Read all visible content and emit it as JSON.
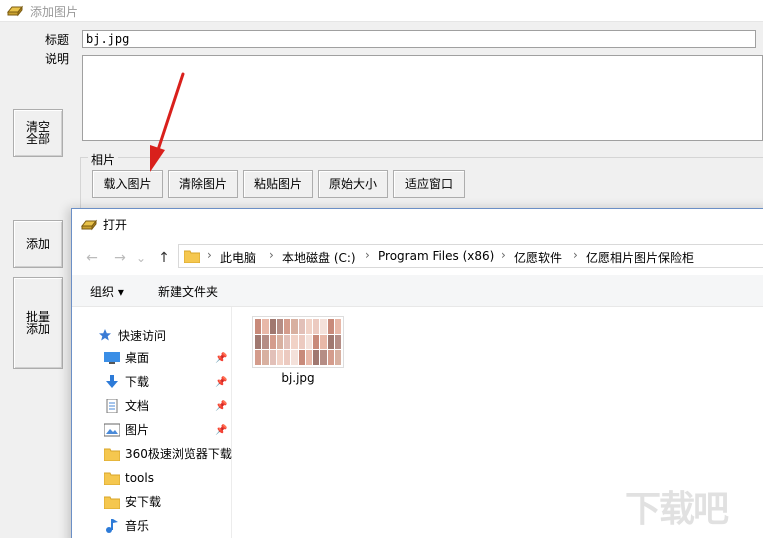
{
  "window": {
    "title": "添加图片"
  },
  "form": {
    "title_label": "标题",
    "title_value": "bj.jpg",
    "desc_label": "说明"
  },
  "side_buttons": {
    "clear_all": "清空全部",
    "add": "添加",
    "batch_add": "批量添加"
  },
  "photo_group": {
    "label": "相片",
    "buttons": [
      "载入图片",
      "清除图片",
      "粘贴图片",
      "原始大小",
      "适应窗口"
    ]
  },
  "dialog": {
    "title": "打开",
    "nav": {
      "back": "←",
      "forward": "→",
      "dropdown": "⌄",
      "up": "↑"
    },
    "breadcrumb": [
      "此电脑",
      "本地磁盘 (C:)",
      "Program Files (x86)",
      "亿愿软件",
      "亿愿相片图片保险柜"
    ],
    "toolbar": {
      "organize": "组织 ▾",
      "new_folder": "新建文件夹"
    },
    "quick_access": "快速访问",
    "nav_items": [
      {
        "label": "桌面",
        "icon": "desktop-icon",
        "pinned": true
      },
      {
        "label": "下载",
        "icon": "download-icon",
        "pinned": true
      },
      {
        "label": "文档",
        "icon": "document-icon",
        "pinned": true
      },
      {
        "label": "图片",
        "icon": "pictures-icon",
        "pinned": true
      },
      {
        "label": "360极速浏览器下载",
        "icon": "folder-icon",
        "pinned": false
      },
      {
        "label": "tools",
        "icon": "folder-icon",
        "pinned": false
      },
      {
        "label": "安下载",
        "icon": "folder-icon",
        "pinned": false
      },
      {
        "label": "音乐",
        "icon": "music-icon",
        "pinned": false
      }
    ],
    "files": [
      {
        "name": "bj.jpg"
      }
    ]
  },
  "watermark": "下载吧",
  "colors": {
    "arrow": "#d9201c",
    "folder": "#f5c74f",
    "dialog_border": "#6b8fc6"
  }
}
